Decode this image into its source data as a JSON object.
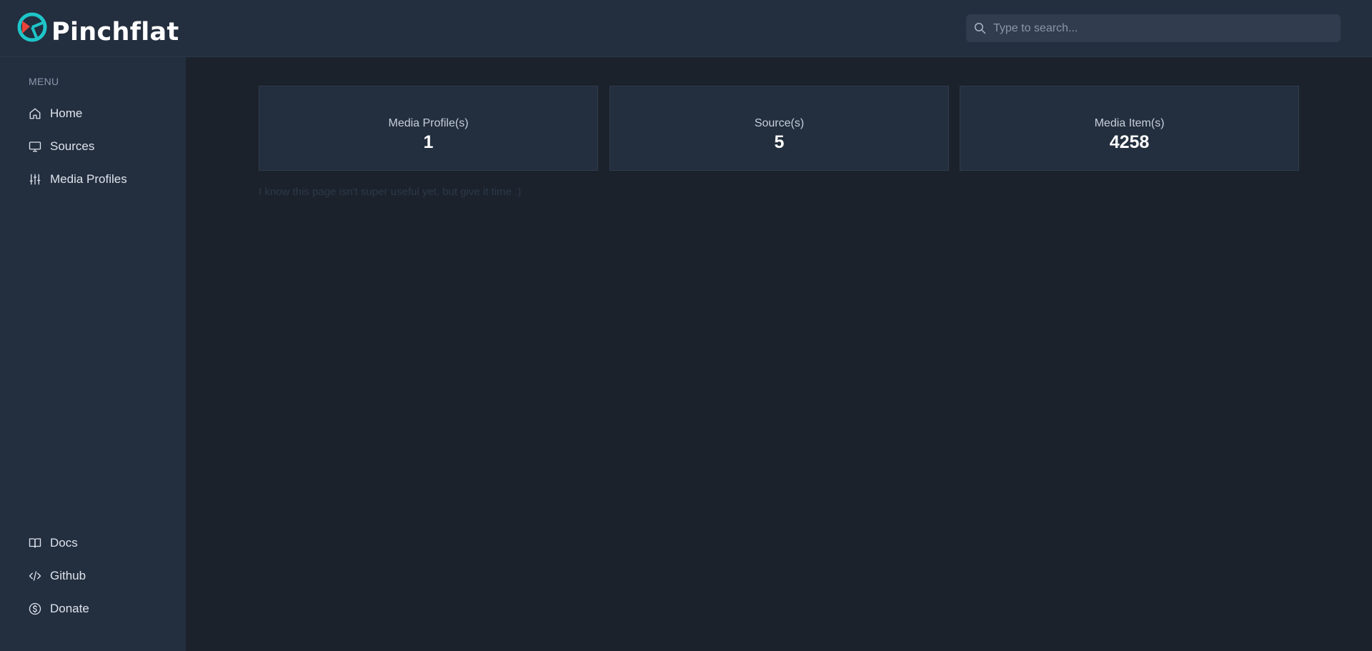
{
  "app": {
    "name": "Pinchflat"
  },
  "search": {
    "placeholder": "Type to search..."
  },
  "sidebar": {
    "menu_heading": "MENU",
    "items": [
      {
        "label": "Home",
        "icon": "home-icon"
      },
      {
        "label": "Sources",
        "icon": "monitor-icon"
      },
      {
        "label": "Media Profiles",
        "icon": "sliders-icon"
      }
    ],
    "footer_items": [
      {
        "label": "Docs",
        "icon": "book-icon"
      },
      {
        "label": "Github",
        "icon": "code-icon"
      },
      {
        "label": "Donate",
        "icon": "dollar-icon"
      }
    ]
  },
  "stats": [
    {
      "label": "Media Profile(s)",
      "value": "1"
    },
    {
      "label": "Source(s)",
      "value": "5"
    },
    {
      "label": "Media Item(s)",
      "value": "4258"
    }
  ],
  "note": "I know this page isn't super useful yet, but give it time :)",
  "colors": {
    "background": "#1b222c",
    "panel": "#232e3e",
    "logo_teal": "#1ec5c9",
    "logo_red": "#e8443b"
  }
}
